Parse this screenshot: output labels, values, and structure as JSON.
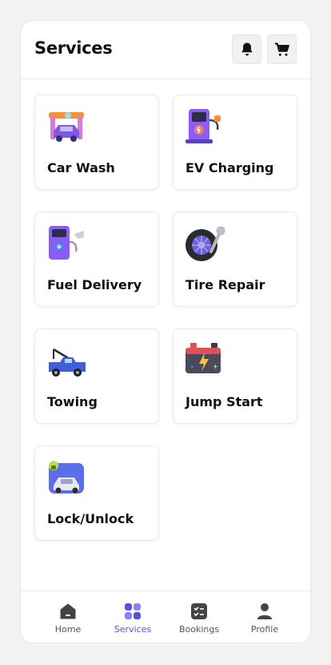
{
  "header": {
    "title": "Services",
    "notifications_icon": "bell-icon",
    "cart_icon": "cart-icon"
  },
  "services": [
    {
      "label": "Car Wash",
      "icon": "car-wash-icon"
    },
    {
      "label": "EV Charging",
      "icon": "ev-charging-icon"
    },
    {
      "label": "Fuel Delivery",
      "icon": "fuel-pump-icon"
    },
    {
      "label": "Tire Repair",
      "icon": "tire-wrench-icon"
    },
    {
      "label": "Towing",
      "icon": "tow-truck-icon"
    },
    {
      "label": "Jump Start",
      "icon": "battery-icon"
    },
    {
      "label": "Lock/Unlock",
      "icon": "car-lock-icon"
    }
  ],
  "nav": [
    {
      "label": "Home",
      "icon": "home-icon",
      "active": false
    },
    {
      "label": "Services",
      "icon": "grid-icon",
      "active": true
    },
    {
      "label": "Bookings",
      "icon": "checklist-icon",
      "active": false
    },
    {
      "label": "Profile",
      "icon": "user-icon",
      "active": false
    }
  ],
  "colors": {
    "accent": "#5b4fe0",
    "background": "#f3f2f0",
    "surface": "#ffffff"
  }
}
